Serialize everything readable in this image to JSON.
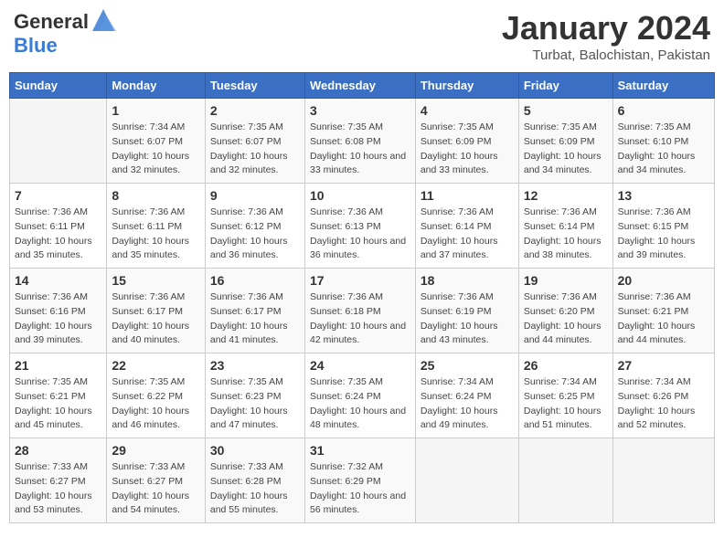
{
  "header": {
    "logo_line1": "General",
    "logo_line2": "Blue",
    "title": "January 2024",
    "subtitle": "Turbat, Balochistan, Pakistan"
  },
  "days_of_week": [
    "Sunday",
    "Monday",
    "Tuesday",
    "Wednesday",
    "Thursday",
    "Friday",
    "Saturday"
  ],
  "weeks": [
    [
      {
        "day": "",
        "sunrise": "",
        "sunset": "",
        "daylight": ""
      },
      {
        "day": "1",
        "sunrise": "Sunrise: 7:34 AM",
        "sunset": "Sunset: 6:07 PM",
        "daylight": "Daylight: 10 hours and 32 minutes."
      },
      {
        "day": "2",
        "sunrise": "Sunrise: 7:35 AM",
        "sunset": "Sunset: 6:07 PM",
        "daylight": "Daylight: 10 hours and 32 minutes."
      },
      {
        "day": "3",
        "sunrise": "Sunrise: 7:35 AM",
        "sunset": "Sunset: 6:08 PM",
        "daylight": "Daylight: 10 hours and 33 minutes."
      },
      {
        "day": "4",
        "sunrise": "Sunrise: 7:35 AM",
        "sunset": "Sunset: 6:09 PM",
        "daylight": "Daylight: 10 hours and 33 minutes."
      },
      {
        "day": "5",
        "sunrise": "Sunrise: 7:35 AM",
        "sunset": "Sunset: 6:09 PM",
        "daylight": "Daylight: 10 hours and 34 minutes."
      },
      {
        "day": "6",
        "sunrise": "Sunrise: 7:35 AM",
        "sunset": "Sunset: 6:10 PM",
        "daylight": "Daylight: 10 hours and 34 minutes."
      }
    ],
    [
      {
        "day": "7",
        "sunrise": "Sunrise: 7:36 AM",
        "sunset": "Sunset: 6:11 PM",
        "daylight": "Daylight: 10 hours and 35 minutes."
      },
      {
        "day": "8",
        "sunrise": "Sunrise: 7:36 AM",
        "sunset": "Sunset: 6:11 PM",
        "daylight": "Daylight: 10 hours and 35 minutes."
      },
      {
        "day": "9",
        "sunrise": "Sunrise: 7:36 AM",
        "sunset": "Sunset: 6:12 PM",
        "daylight": "Daylight: 10 hours and 36 minutes."
      },
      {
        "day": "10",
        "sunrise": "Sunrise: 7:36 AM",
        "sunset": "Sunset: 6:13 PM",
        "daylight": "Daylight: 10 hours and 36 minutes."
      },
      {
        "day": "11",
        "sunrise": "Sunrise: 7:36 AM",
        "sunset": "Sunset: 6:14 PM",
        "daylight": "Daylight: 10 hours and 37 minutes."
      },
      {
        "day": "12",
        "sunrise": "Sunrise: 7:36 AM",
        "sunset": "Sunset: 6:14 PM",
        "daylight": "Daylight: 10 hours and 38 minutes."
      },
      {
        "day": "13",
        "sunrise": "Sunrise: 7:36 AM",
        "sunset": "Sunset: 6:15 PM",
        "daylight": "Daylight: 10 hours and 39 minutes."
      }
    ],
    [
      {
        "day": "14",
        "sunrise": "Sunrise: 7:36 AM",
        "sunset": "Sunset: 6:16 PM",
        "daylight": "Daylight: 10 hours and 39 minutes."
      },
      {
        "day": "15",
        "sunrise": "Sunrise: 7:36 AM",
        "sunset": "Sunset: 6:17 PM",
        "daylight": "Daylight: 10 hours and 40 minutes."
      },
      {
        "day": "16",
        "sunrise": "Sunrise: 7:36 AM",
        "sunset": "Sunset: 6:17 PM",
        "daylight": "Daylight: 10 hours and 41 minutes."
      },
      {
        "day": "17",
        "sunrise": "Sunrise: 7:36 AM",
        "sunset": "Sunset: 6:18 PM",
        "daylight": "Daylight: 10 hours and 42 minutes."
      },
      {
        "day": "18",
        "sunrise": "Sunrise: 7:36 AM",
        "sunset": "Sunset: 6:19 PM",
        "daylight": "Daylight: 10 hours and 43 minutes."
      },
      {
        "day": "19",
        "sunrise": "Sunrise: 7:36 AM",
        "sunset": "Sunset: 6:20 PM",
        "daylight": "Daylight: 10 hours and 44 minutes."
      },
      {
        "day": "20",
        "sunrise": "Sunrise: 7:36 AM",
        "sunset": "Sunset: 6:21 PM",
        "daylight": "Daylight: 10 hours and 44 minutes."
      }
    ],
    [
      {
        "day": "21",
        "sunrise": "Sunrise: 7:35 AM",
        "sunset": "Sunset: 6:21 PM",
        "daylight": "Daylight: 10 hours and 45 minutes."
      },
      {
        "day": "22",
        "sunrise": "Sunrise: 7:35 AM",
        "sunset": "Sunset: 6:22 PM",
        "daylight": "Daylight: 10 hours and 46 minutes."
      },
      {
        "day": "23",
        "sunrise": "Sunrise: 7:35 AM",
        "sunset": "Sunset: 6:23 PM",
        "daylight": "Daylight: 10 hours and 47 minutes."
      },
      {
        "day": "24",
        "sunrise": "Sunrise: 7:35 AM",
        "sunset": "Sunset: 6:24 PM",
        "daylight": "Daylight: 10 hours and 48 minutes."
      },
      {
        "day": "25",
        "sunrise": "Sunrise: 7:34 AM",
        "sunset": "Sunset: 6:24 PM",
        "daylight": "Daylight: 10 hours and 49 minutes."
      },
      {
        "day": "26",
        "sunrise": "Sunrise: 7:34 AM",
        "sunset": "Sunset: 6:25 PM",
        "daylight": "Daylight: 10 hours and 51 minutes."
      },
      {
        "day": "27",
        "sunrise": "Sunrise: 7:34 AM",
        "sunset": "Sunset: 6:26 PM",
        "daylight": "Daylight: 10 hours and 52 minutes."
      }
    ],
    [
      {
        "day": "28",
        "sunrise": "Sunrise: 7:33 AM",
        "sunset": "Sunset: 6:27 PM",
        "daylight": "Daylight: 10 hours and 53 minutes."
      },
      {
        "day": "29",
        "sunrise": "Sunrise: 7:33 AM",
        "sunset": "Sunset: 6:27 PM",
        "daylight": "Daylight: 10 hours and 54 minutes."
      },
      {
        "day": "30",
        "sunrise": "Sunrise: 7:33 AM",
        "sunset": "Sunset: 6:28 PM",
        "daylight": "Daylight: 10 hours and 55 minutes."
      },
      {
        "day": "31",
        "sunrise": "Sunrise: 7:32 AM",
        "sunset": "Sunset: 6:29 PM",
        "daylight": "Daylight: 10 hours and 56 minutes."
      },
      {
        "day": "",
        "sunrise": "",
        "sunset": "",
        "daylight": ""
      },
      {
        "day": "",
        "sunrise": "",
        "sunset": "",
        "daylight": ""
      },
      {
        "day": "",
        "sunrise": "",
        "sunset": "",
        "daylight": ""
      }
    ]
  ]
}
